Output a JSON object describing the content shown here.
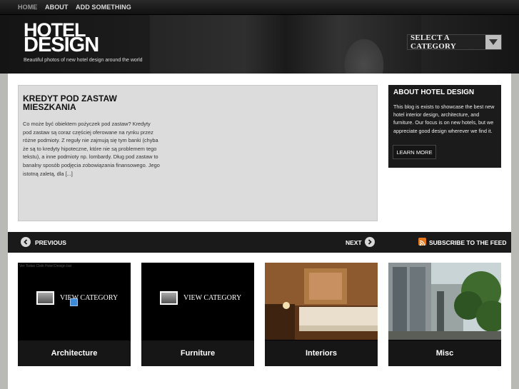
{
  "nav": {
    "items": [
      "HOME",
      "ABOUT",
      "ADD SOMETHING"
    ]
  },
  "header": {
    "logo_line1": "HOTEL",
    "logo_line2": "DESIGN",
    "tagline": "Beautiful photos of new hotel design around the world",
    "category_select": "SELECT A CATEGORY"
  },
  "post": {
    "title": "KREDYT POD ZASTAW MIESZKANIA",
    "excerpt": "Co może być obiektem pożyczek pod zastaw? Kredyty pod zastaw są coraz częściej oferowane na rynku przez różne podmioty. Z reguły nie zajmują się tym banki (chyba że są to kredyty hipoteczne, które nie są problemem tego tekstu), a inne podmioty np. lombardy. Dług pod zastaw to banalny sposób podjęcia zobowiązania finansowego. Jego istotną zaletą, dla [...]"
  },
  "about": {
    "title": "ABOUT HOTEL DESIGN",
    "text": "This blog is exists to showcase the best new hotel interior design, architecture, and furniture. Our focus is on new hotels, but we appreciate good design wherever we find it.",
    "button": "LEARN MORE"
  },
  "pager": {
    "previous": "PREVIOUS",
    "next": "NEXT",
    "subscribe": "SUBSCRIBE TO THE FEED"
  },
  "categories": [
    {
      "name": "Architecture",
      "overlay": "VIEW CATEGORY",
      "alt": "Ver Todas Cleik Hotel Design bar"
    },
    {
      "name": "Furniture",
      "overlay": "VIEW CATEGORY"
    },
    {
      "name": "Interiors"
    },
    {
      "name": "Misc"
    }
  ],
  "colors": {
    "rss": "#e2781b",
    "panel_dark": "#1b1b1b"
  }
}
